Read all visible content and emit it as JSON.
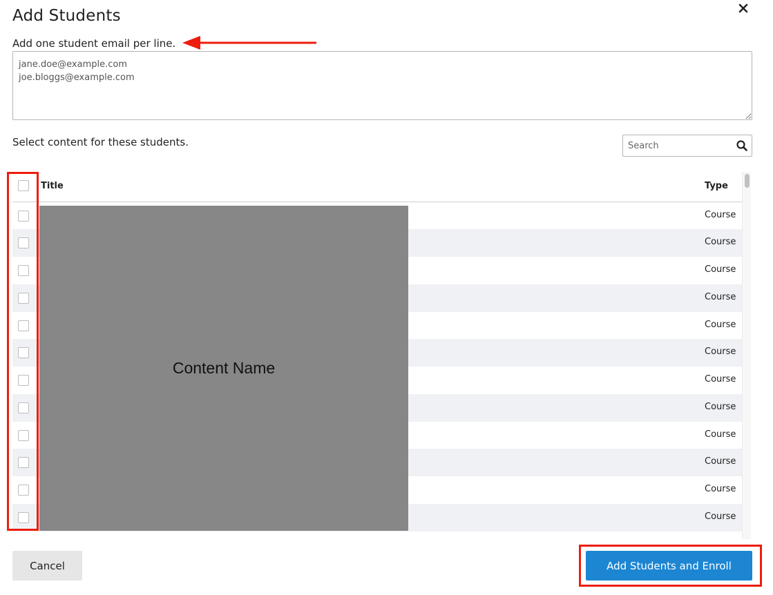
{
  "dialog": {
    "title": "Add Students",
    "close_icon": "close-icon",
    "instruction": "Add one student email per line.",
    "emails_value": "jane.doe@example.com\njoe.bloggs@example.com",
    "select_prompt": "Select content for these students.",
    "search": {
      "placeholder": "Search",
      "icon": "search-icon"
    }
  },
  "table": {
    "columns": {
      "title": "Title",
      "type": "Type"
    },
    "content_placeholder": "Content Name",
    "rows": [
      {
        "title": "",
        "type": "Course"
      },
      {
        "title": "",
        "type": "Course"
      },
      {
        "title": "",
        "type": "Course"
      },
      {
        "title": "",
        "type": "Course"
      },
      {
        "title": "",
        "type": "Course"
      },
      {
        "title": "",
        "type": "Course"
      },
      {
        "title": "",
        "type": "Course"
      },
      {
        "title": "",
        "type": "Course"
      },
      {
        "title": "",
        "type": "Course"
      },
      {
        "title": "",
        "type": "Course"
      },
      {
        "title": "",
        "type": "Course"
      },
      {
        "title": "",
        "type": "Course"
      }
    ]
  },
  "footer": {
    "cancel_label": "Cancel",
    "submit_label": "Add Students and Enroll"
  },
  "colors": {
    "primary": "#1c86d3",
    "annotation": "#ee1c0e",
    "row_alt": "#f0f1f5",
    "placeholder_block": "#878787"
  }
}
